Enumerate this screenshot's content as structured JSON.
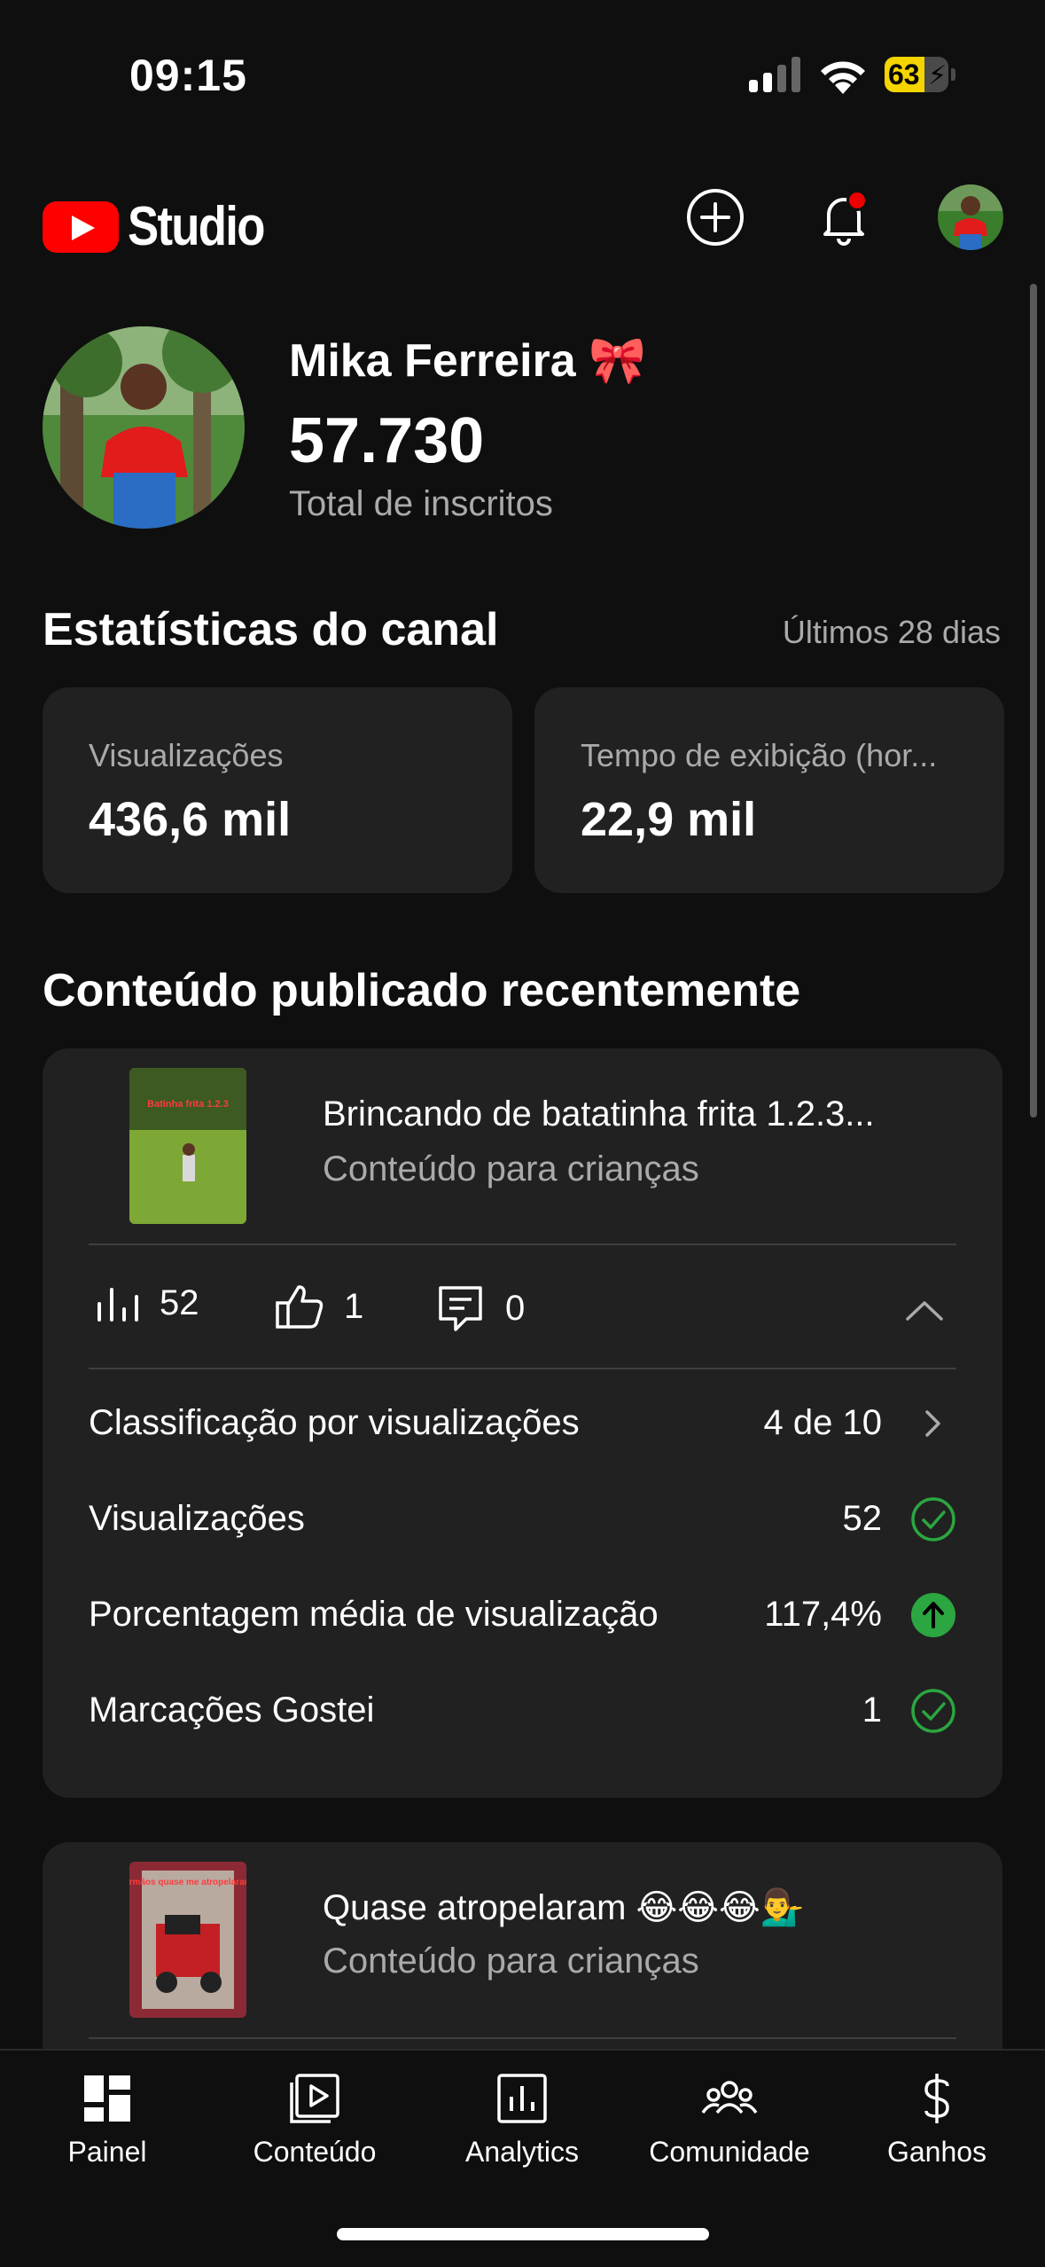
{
  "status_bar": {
    "time": "09:15",
    "battery_level": "63",
    "battery_fraction": 0.63
  },
  "header": {
    "brand": "Studio"
  },
  "channel": {
    "name": "Mika Ferreira 🎀",
    "subscriber_count": "57.730",
    "subscriber_label": "Total de inscritos"
  },
  "stats": {
    "title": "Estatísticas do canal",
    "period": "Últimos 28 dias",
    "cards": [
      {
        "label": "Visualizações",
        "value": "436,6 mil"
      },
      {
        "label": "Tempo de exibição (hor...",
        "value": "22,9 mil"
      }
    ]
  },
  "recent": {
    "title": "Conteúdo publicado recentemente",
    "items": [
      {
        "title": "Brincando de batatinha frita 1.2.3...",
        "subtitle": "Conteúdo para crianças",
        "thumb_text": "Batinha frita 1.2.3",
        "views": "52",
        "likes": "1",
        "comments": "0",
        "details": [
          {
            "label": "Classificação por visualizações",
            "value": "4 de 10",
            "icon": "chevron-right-icon"
          },
          {
            "label": "Visualizações",
            "value": "52",
            "icon": "check-circle-icon"
          },
          {
            "label": "Porcentagem média de visualização",
            "value": "117,4%",
            "icon": "arrow-up-circle-icon"
          },
          {
            "label": "Marcações Gostei",
            "value": "1",
            "icon": "check-circle-icon"
          }
        ]
      },
      {
        "title": "Quase atropelaram 😂😂😂💁‍♂️",
        "subtitle": "Conteúdo para crianças",
        "thumb_text": "Meus irmãos quase me atropelaram kkkk"
      }
    ]
  },
  "nav": [
    {
      "label": "Painel",
      "icon": "dashboard-icon"
    },
    {
      "label": "Conteúdo",
      "icon": "content-icon"
    },
    {
      "label": "Analytics",
      "icon": "analytics-icon"
    },
    {
      "label": "Comunidade",
      "icon": "community-icon"
    },
    {
      "label": "Ganhos",
      "icon": "earnings-icon"
    }
  ],
  "colors": {
    "accent_red": "#ff0000",
    "success_green": "#2ba640",
    "card_bg": "#212121",
    "battery_yellow": "#f5d400"
  }
}
